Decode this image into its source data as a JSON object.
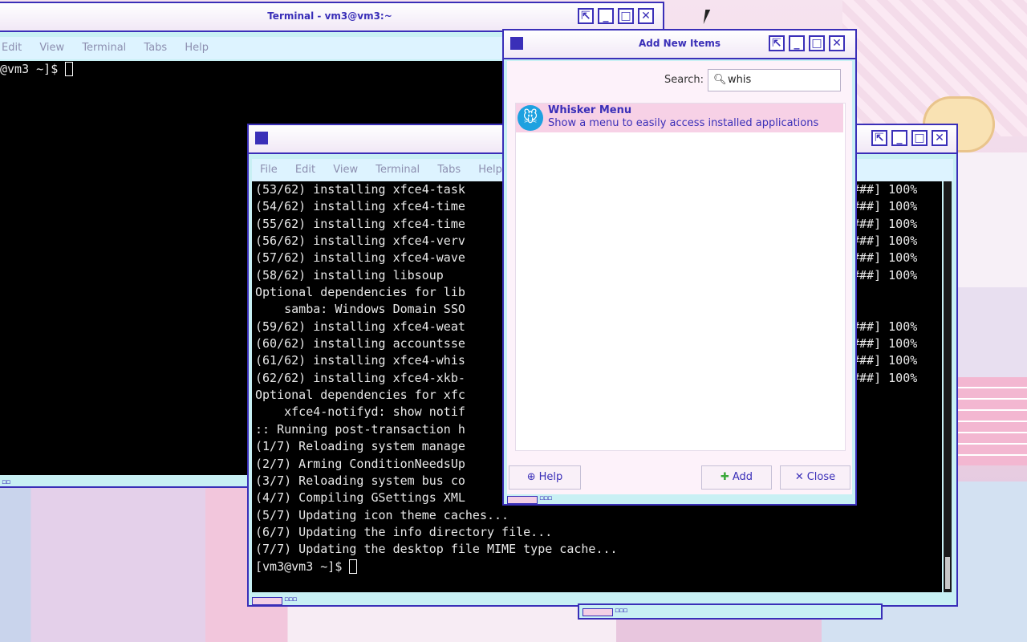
{
  "back_terminal": {
    "title": "Terminal - vm3@vm3:~",
    "menu": [
      "Edit",
      "View",
      "Terminal",
      "Tabs",
      "Help"
    ],
    "prompt": "@vm3 ~]$ "
  },
  "front_terminal": {
    "menu": [
      "File",
      "Edit",
      "View",
      "Terminal",
      "Tabs",
      "Help"
    ],
    "lines_left": [
      "(53/62) installing xfce4-task",
      "(54/62) installing xfce4-time",
      "(55/62) installing xfce4-time",
      "(56/62) installing xfce4-verv",
      "(57/62) installing xfce4-wave",
      "(58/62) installing libsoup",
      "Optional dependencies for lib",
      "    samba: Windows Domain SSO",
      "(59/62) installing xfce4-weat",
      "(60/62) installing accountsse",
      "(61/62) installing xfce4-whis",
      "(62/62) installing xfce4-xkb-",
      "Optional dependencies for xfc",
      "    xfce4-notifyd: show notif",
      ":: Running post-transaction h",
      "(1/7) Reloading system manage",
      "(2/7) Arming ConditionNeedsUp",
      "(3/7) Reloading system bus co",
      "(4/7) Compiling GSettings XML",
      "(5/7) Updating icon theme caches...",
      "(6/7) Updating the info directory file...",
      "(7/7) Updating the desktop file MIME type cache...",
      "[vm3@vm3 ~]$ "
    ],
    "lines_right": [
      "###] 100%",
      "###] 100%",
      "###] 100%",
      "###] 100%",
      "###] 100%",
      "###] 100%",
      "",
      "",
      "###] 100%",
      "###] 100%",
      "###] 100%",
      "###] 100%"
    ]
  },
  "dialog": {
    "title": "Add New Items",
    "search_label": "Search:",
    "search_value": "whis",
    "items": [
      {
        "title": "Whisker Menu",
        "description": "Show a menu to easily access installed applications"
      }
    ],
    "buttons": {
      "help": "Help",
      "add": "Add",
      "close": "Close"
    }
  },
  "colors": {
    "border": "#3a2fb8",
    "frame": "#c8f0f4",
    "selection": "#f7d1e6"
  }
}
